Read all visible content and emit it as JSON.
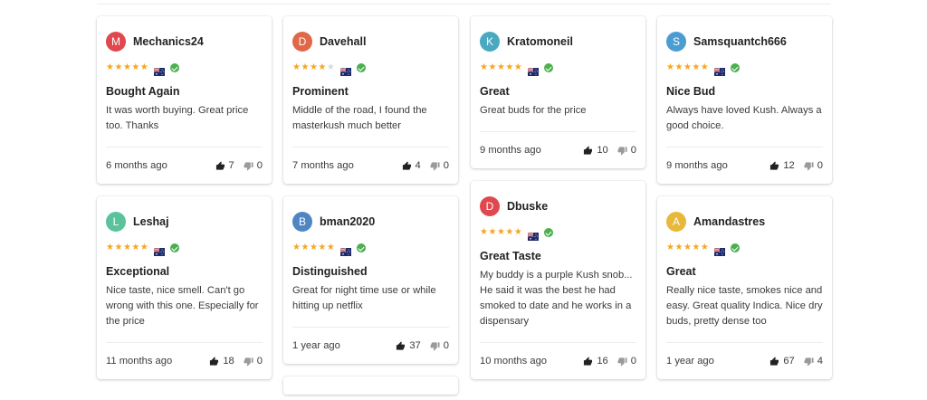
{
  "colors": {
    "star": "#f5a623",
    "verified": "#4caf50",
    "avatar_red": "#e0484f",
    "avatar_orange": "#e06748",
    "avatar_teal": "#4aa8c0",
    "avatar_blue": "#4a9dd3",
    "avatar_green": "#5bc39b",
    "avatar_steel": "#4e86c4",
    "avatar_yellow": "#e8b83a"
  },
  "columns": [
    {
      "reviews": [
        {
          "initial": "M",
          "avatar_color": "#e0484f",
          "user": "Mechanics24",
          "stars": 5,
          "country_flag": "australia-flag-icon",
          "verified_icon": "verified-check-icon",
          "title": "Bought Again",
          "text": "It was worth buying. Great price too. Thanks",
          "time": "6 months ago",
          "up": "7",
          "down": "0"
        },
        {
          "initial": "L",
          "avatar_color": "#5bc39b",
          "user": "Leshaj",
          "stars": 5,
          "country_flag": "australia-flag-icon",
          "verified_icon": "verified-check-icon",
          "title": "Exceptional",
          "text": "Nice taste, nice smell. Can't go wrong with this one. Especially for the price",
          "time": "11 months ago",
          "up": "18",
          "down": "0"
        }
      ]
    },
    {
      "reviews": [
        {
          "initial": "D",
          "avatar_color": "#e06748",
          "user": "Davehall",
          "stars": 4,
          "country_flag": "australia-flag-icon",
          "verified_icon": "verified-check-icon",
          "title": "Prominent",
          "text": "Middle of the road, I found the masterkush much better",
          "time": "7 months ago",
          "up": "4",
          "down": "0"
        },
        {
          "initial": "B",
          "avatar_color": "#4e86c4",
          "user": "bman2020",
          "stars": 5,
          "country_flag": "australia-flag-icon",
          "verified_icon": "verified-check-icon",
          "title": "Distinguished",
          "text": "Great for night time use or while hitting up netflix",
          "time": "1 year ago",
          "up": "37",
          "down": "0"
        }
      ]
    },
    {
      "reviews": [
        {
          "initial": "K",
          "avatar_color": "#4aa8c0",
          "user": "Kratomoneil",
          "stars": 5,
          "country_flag": "australia-flag-icon",
          "verified_icon": "verified-check-icon",
          "title": "Great",
          "text": "Great buds for the price",
          "time": "9 months ago",
          "up": "10",
          "down": "0"
        },
        {
          "initial": "D",
          "avatar_color": "#e0484f",
          "user": "Dbuske",
          "stars": 5,
          "country_flag": "australia-flag-icon",
          "verified_icon": "verified-check-icon",
          "title": "Great Taste",
          "text": "My buddy is a purple Kush snob... He said it was the best he had smoked to date and he works in a dispensary",
          "time": "10 months ago",
          "up": "16",
          "down": "0"
        }
      ]
    },
    {
      "reviews": [
        {
          "initial": "S",
          "avatar_color": "#4a9dd3",
          "user": "Samsquantch666",
          "stars": 5,
          "country_flag": "australia-flag-icon",
          "verified_icon": "verified-check-icon",
          "title": "Nice Bud",
          "text": "Always have loved Kush. Always a good choice.",
          "time": "9 months ago",
          "up": "12",
          "down": "0"
        },
        {
          "initial": "A",
          "avatar_color": "#e8b83a",
          "user": "Amandastres",
          "stars": 5,
          "country_flag": "australia-flag-icon",
          "verified_icon": "verified-check-icon",
          "title": "Great",
          "text": "Really nice taste, smokes nice and easy. Great quality Indica. Nice dry buds, pretty dense too",
          "time": "1 year ago",
          "up": "67",
          "down": "4"
        }
      ]
    }
  ]
}
